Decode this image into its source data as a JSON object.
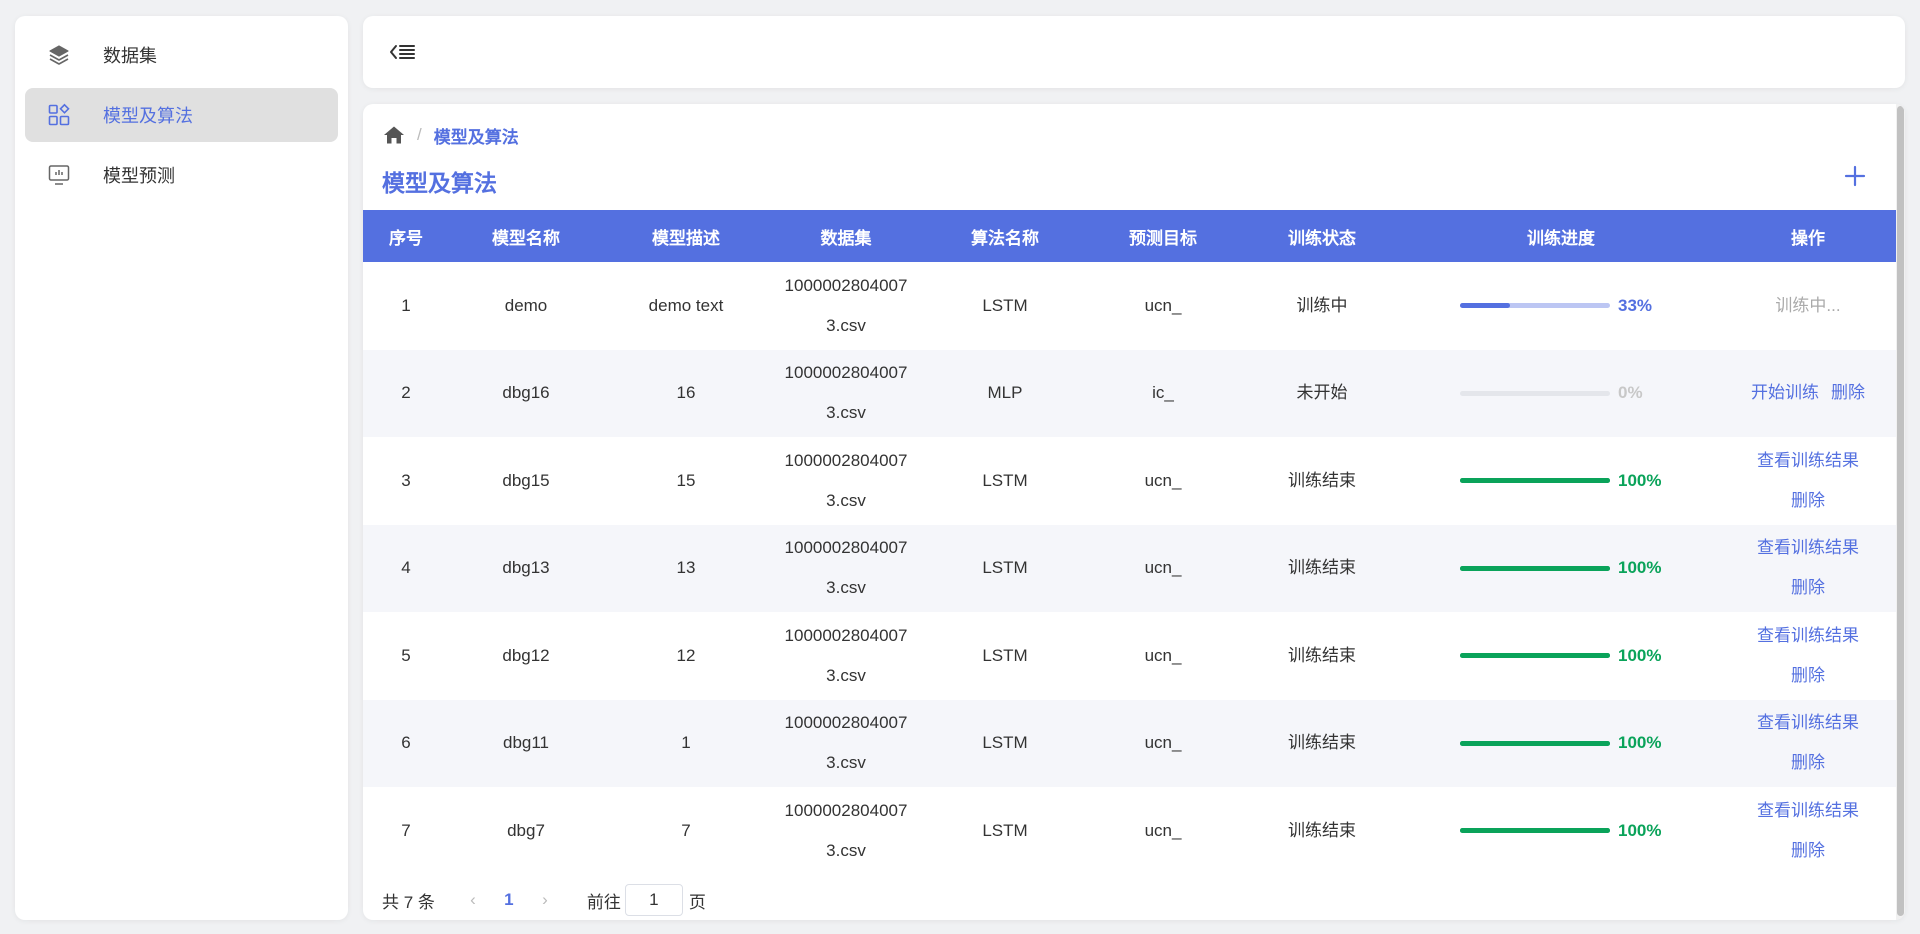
{
  "sidebar": {
    "items": [
      {
        "label": "数据集",
        "icon": "layers-icon",
        "active": false
      },
      {
        "label": "模型及算法",
        "icon": "grid-apps-icon",
        "active": true
      },
      {
        "label": "模型预测",
        "icon": "monitor-icon",
        "active": false
      }
    ]
  },
  "breadcrumb": {
    "current": "模型及算法"
  },
  "page_title": "模型及算法",
  "colors": {
    "accent": "#5470e0",
    "success": "#0aa35a",
    "track": "#e4e6eb",
    "track_active": "#bcc6f3"
  },
  "table": {
    "headers": [
      "序号",
      "模型名称",
      "模型描述",
      "数据集",
      "算法名称",
      "预测目标",
      "训练状态",
      "训练进度",
      "操作"
    ],
    "rows": [
      {
        "no": "1",
        "name": "demo",
        "desc": "demo text",
        "dataset": "10000028040073.csv",
        "algo": "LSTM",
        "target": "ucn_",
        "status": "训练中",
        "progress": 0.33,
        "progress_label": "33%",
        "op1": "训练中...",
        "op2": ""
      },
      {
        "no": "2",
        "name": "dbg16",
        "desc": "16",
        "dataset": "10000028040073.csv",
        "algo": "MLP",
        "target": "ic_",
        "status": "未开始",
        "progress": 0,
        "progress_label": "0%",
        "op1": "开始训练",
        "op2": "删除"
      },
      {
        "no": "3",
        "name": "dbg15",
        "desc": "15",
        "dataset": "10000028040073.csv",
        "algo": "LSTM",
        "target": "ucn_",
        "status": "训练结束",
        "progress": 1,
        "progress_label": "100%",
        "op1": "查看训练结果",
        "op2": "删除"
      },
      {
        "no": "4",
        "name": "dbg13",
        "desc": "13",
        "dataset": "10000028040073.csv",
        "algo": "LSTM",
        "target": "ucn_",
        "status": "训练结束",
        "progress": 1,
        "progress_label": "100%",
        "op1": "查看训练结果",
        "op2": "删除"
      },
      {
        "no": "5",
        "name": "dbg12",
        "desc": "12",
        "dataset": "10000028040073.csv",
        "algo": "LSTM",
        "target": "ucn_",
        "status": "训练结束",
        "progress": 1,
        "progress_label": "100%",
        "op1": "查看训练结果",
        "op2": "删除"
      },
      {
        "no": "6",
        "name": "dbg11",
        "desc": "1",
        "dataset": "10000028040073.csv",
        "algo": "LSTM",
        "target": "ucn_",
        "status": "训练结束",
        "progress": 1,
        "progress_label": "100%",
        "op1": "查看训练结果",
        "op2": "删除"
      },
      {
        "no": "7",
        "name": "dbg7",
        "desc": "7",
        "dataset": "10000028040073.csv",
        "algo": "LSTM",
        "target": "ucn_",
        "status": "训练结束",
        "progress": 1,
        "progress_label": "100%",
        "op1": "查看训练结果",
        "op2": "删除"
      }
    ]
  },
  "pagination": {
    "total_label": "共 7 条",
    "current_page": "1",
    "goto_label": "前往",
    "goto_value": "1",
    "goto_suffix": "页"
  }
}
